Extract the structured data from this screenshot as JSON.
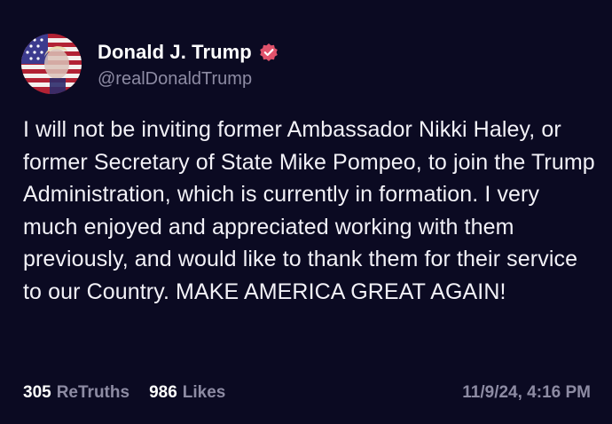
{
  "post": {
    "author": {
      "display_name": "Donald J. Trump",
      "handle": "@realDonaldTrump",
      "verified": true,
      "avatar_icon": "flag-portrait-avatar"
    },
    "text": "I will not be inviting former Ambassador Nikki Haley, or former Secretary of State Mike Pompeo, to join the Trump Administration, which is currently in formation. I very much enjoyed and appreciated working with them previously, and would like to thank them for their service to our Country. MAKE AMERICA GREAT AGAIN!",
    "stats": {
      "retruths_count": "305",
      "retruths_label": "ReTruths",
      "likes_count": "986",
      "likes_label": "Likes"
    },
    "timestamp": "11/9/24, 4:16 PM"
  },
  "colors": {
    "background": "#0b0a22",
    "text": "#f2f1f7",
    "muted": "#8d8ba3",
    "verified_badge": "#e0526b"
  }
}
